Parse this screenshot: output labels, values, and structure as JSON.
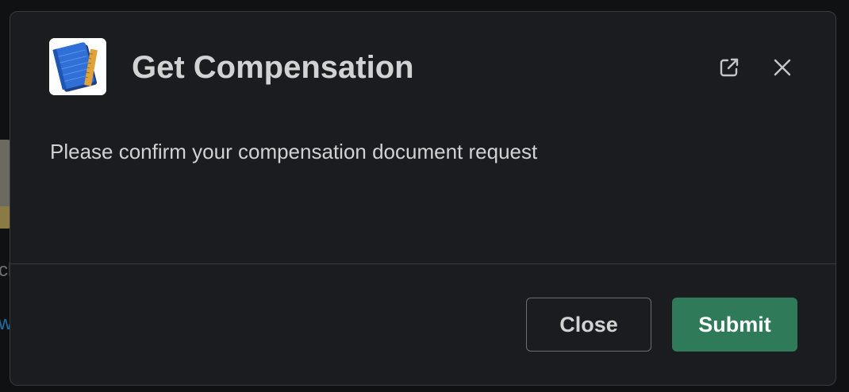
{
  "background": {
    "partial_text_1": "ch",
    "partial_text_2": "w"
  },
  "modal": {
    "app_icon": "notebook-ruler-icon",
    "title": "Get Compensation",
    "body_text": "Please confirm your compensation document request",
    "header_actions": [
      {
        "icon": "external-link-icon"
      },
      {
        "icon": "close-icon"
      }
    ],
    "footer": {
      "close_label": "Close",
      "submit_label": "Submit"
    }
  },
  "colors": {
    "modal_background": "#1b1c1f",
    "primary_button": "#2f7a59",
    "text": "#d1d2d3"
  }
}
